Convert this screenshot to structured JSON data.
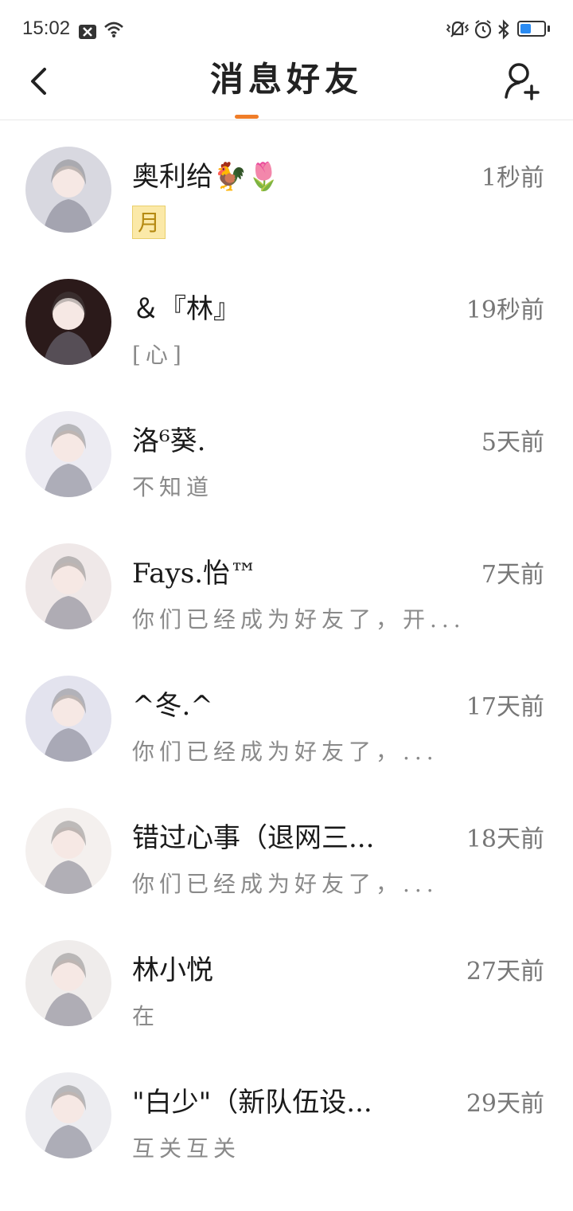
{
  "status_bar": {
    "time": "15:02",
    "battery_level": 0.45,
    "icons": [
      "close-box-icon",
      "wifi-icon",
      "vibrate-icon",
      "alarm-icon",
      "bluetooth-icon",
      "battery-icon"
    ]
  },
  "header": {
    "title": "消息好友",
    "back_icon": "chevron-left-icon",
    "add_icon": "add-user-icon",
    "accent_color": "#f07d28"
  },
  "friends": [
    {
      "name": "奥利给🐓🌷",
      "time": "1秒前",
      "preview": "",
      "badge": "月",
      "avatar_color": "#d8d8e0"
    },
    {
      "name": "＆『林』",
      "time": "19秒前",
      "preview": "[心]",
      "avatar_color": "#2b1a1a"
    },
    {
      "name": "洛⁶葵.",
      "time": "5天前",
      "preview": "不知道",
      "avatar_color": "#ecebf2"
    },
    {
      "name": "Fays.怡™",
      "time": "7天前",
      "preview": "你们已经成为好友了，开...",
      "avatar_color": "#efe8e8"
    },
    {
      "name": "^冬.^",
      "time": "17天前",
      "preview": "你们已经成为好友了，...",
      "avatar_color": "#e3e3ee"
    },
    {
      "name": "错过心事（退网三...",
      "time": "18天前",
      "preview": "你们已经成为好友了，...",
      "avatar_color": "#f4f0ee"
    },
    {
      "name": "林小悦",
      "time": "27天前",
      "preview": "在",
      "avatar_color": "#efeceb"
    },
    {
      "name": "\"白少\"（新队伍设...",
      "time": "29天前",
      "preview": "互关互关",
      "avatar_color": "#ececf0"
    }
  ]
}
